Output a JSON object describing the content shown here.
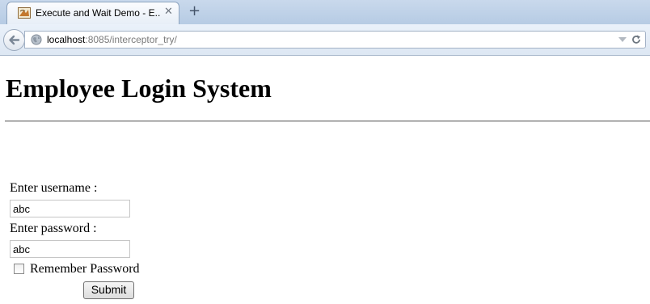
{
  "browser": {
    "tab_title": "Execute and Wait Demo - E...",
    "url_host": "localhost",
    "url_rest": ":8085/interceptor_try/"
  },
  "page": {
    "title": "Employee Login System",
    "form": {
      "username_label": "Enter username :",
      "username_value": "abc",
      "password_label": "Enter password :",
      "password_value": "abc",
      "remember_label": "Remember Password",
      "remember_checked": false,
      "submit_label": "Submit"
    }
  },
  "icons": {
    "favicon": "favicon-icon",
    "tab_close": "close-icon",
    "new_tab": "plus-icon",
    "back": "back-arrow-icon",
    "site": "globe-icon",
    "dropdown": "dropdown-icon",
    "reload": "reload-icon"
  }
}
